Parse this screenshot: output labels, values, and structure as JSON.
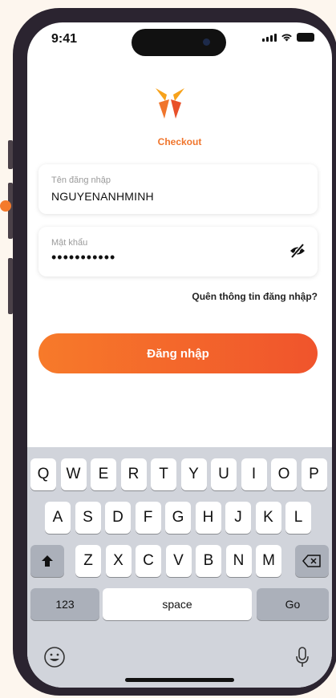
{
  "status_bar": {
    "time": "9:41"
  },
  "brand": {
    "name": "Checkout",
    "accent": "#f0752c"
  },
  "form": {
    "username_label": "Tên đăng nhập",
    "username_value": "NGUYENANHMINH",
    "password_label": "Mật khẩu",
    "password_value": "•••••••••••",
    "forgot_link": "Quên thông tin đăng nhập?",
    "login_button": "Đăng nhập"
  },
  "keyboard": {
    "row1": [
      "Q",
      "W",
      "E",
      "R",
      "T",
      "Y",
      "U",
      "I",
      "O",
      "P"
    ],
    "row2": [
      "A",
      "S",
      "D",
      "F",
      "G",
      "H",
      "J",
      "K",
      "L"
    ],
    "row3": [
      "Z",
      "X",
      "C",
      "V",
      "B",
      "N",
      "M"
    ],
    "numbers_key": "123",
    "space_key": "space",
    "go_key": "Go",
    "icons": [
      "shift-icon",
      "backspace-icon",
      "emoji-icon",
      "microphone-icon"
    ]
  }
}
